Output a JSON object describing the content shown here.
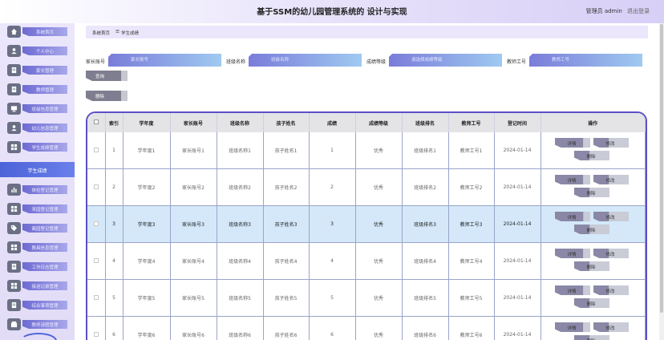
{
  "header": {
    "title": "基于SSM的幼儿园管理系统的 设计与实现",
    "user_label": "管理员 admin",
    "logout_label": "退出登录"
  },
  "sidebar": {
    "items": [
      {
        "label": "系统首页",
        "icon": "home-icon"
      },
      {
        "label": "个人中心",
        "icon": "user-icon"
      },
      {
        "label": "家长管理",
        "icon": "document-icon"
      },
      {
        "label": "教师管理",
        "icon": "document-icon"
      },
      {
        "label": "班级信息管理",
        "icon": "monitor-icon"
      },
      {
        "label": "幼儿信息管理",
        "icon": "user-icon"
      },
      {
        "label": "学生成绩管理",
        "icon": "grid-icon"
      }
    ],
    "active_label": "学生成绩",
    "items_after": [
      {
        "label": "体检登记管理",
        "icon": "chart-icon"
      },
      {
        "label": "来园登记管理",
        "icon": "grid-icon"
      },
      {
        "label": "离园登记管理",
        "icon": "tag-icon"
      },
      {
        "label": "教具信息管理",
        "icon": "grid-icon"
      },
      {
        "label": "工作日志管理",
        "icon": "document-icon"
      },
      {
        "label": "接送记录管理",
        "icon": "grid-icon"
      },
      {
        "label": "综合事项管理",
        "icon": "document-icon"
      },
      {
        "label": "教师请假管理",
        "icon": "box-icon"
      }
    ]
  },
  "breadcrumb": {
    "home": "系统首页",
    "separator": "☰",
    "current": "学生成绩"
  },
  "search": {
    "fields": [
      {
        "label": "家长账号",
        "placeholder": "家长账号"
      },
      {
        "label": "班级名称",
        "placeholder": "班级名称"
      },
      {
        "label": "成绩等级",
        "placeholder": "请选择成绩等级"
      },
      {
        "label": "教师工号",
        "placeholder": "教师工号"
      }
    ],
    "query_label": "查询",
    "delete_label": "删除"
  },
  "table": {
    "headers": [
      "",
      "索引",
      "学年度",
      "家长账号",
      "班级名称",
      "孩子姓名",
      "成绩",
      "成绩等级",
      "班级排名",
      "教师工号",
      "登记时间",
      "操作"
    ],
    "rows": [
      {
        "index": "1",
        "year": "学年度1",
        "parent": "家长账号1",
        "class": "班级名称1",
        "child": "孩子姓名1",
        "score": "1",
        "grade": "优秀",
        "rank": "班级排名1",
        "teacher": "教师工号1",
        "time": "2024-01-14"
      },
      {
        "index": "2",
        "year": "学年度2",
        "parent": "家长账号2",
        "class": "班级名称2",
        "child": "孩子姓名2",
        "score": "2",
        "grade": "优秀",
        "rank": "班级排名2",
        "teacher": "教师工号2",
        "time": "2024-01-14"
      },
      {
        "index": "3",
        "year": "学年度3",
        "parent": "家长账号3",
        "class": "班级名称3",
        "child": "孩子姓名3",
        "score": "3",
        "grade": "优秀",
        "rank": "班级排名3",
        "teacher": "教师工号3",
        "time": "2024-01-14"
      },
      {
        "index": "4",
        "year": "学年度4",
        "parent": "家长账号4",
        "class": "班级名称4",
        "child": "孩子姓名4",
        "score": "4",
        "grade": "优秀",
        "rank": "班级排名4",
        "teacher": "教师工号4",
        "time": "2024-01-14"
      },
      {
        "index": "5",
        "year": "学年度5",
        "parent": "家长账号5",
        "class": "班级名称5",
        "child": "孩子姓名5",
        "score": "5",
        "grade": "优秀",
        "rank": "班级排名5",
        "teacher": "教师工号5",
        "time": "2024-01-14"
      },
      {
        "index": "6",
        "year": "学年度6",
        "parent": "家长账号6",
        "class": "班级名称6",
        "child": "孩子姓名6",
        "score": "6",
        "grade": "优秀",
        "rank": "班级排名6",
        "teacher": "教师工号6",
        "time": "2024-01-14"
      }
    ],
    "ops": {
      "detail": "详情",
      "edit": "修改",
      "delete": "删除"
    }
  },
  "colors": {
    "accent": "#5b50c6",
    "active_nav": "#4c62d8",
    "selected_row": "#d4e8f9"
  }
}
